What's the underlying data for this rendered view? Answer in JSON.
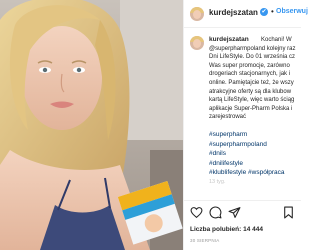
{
  "header": {
    "username": "kurdejszatan",
    "verified_mark": "✔",
    "separator": "•",
    "follow_label": "Obserwuj"
  },
  "caption": {
    "username": "kurdejszatan",
    "text": "Kochani! W\n@superpharmpoland kolejny raz\nDni LifeStyle. Do 01 września cz\nWas super promocje, zarówno\ndrogeriach stacjonarnych, jak i\nonline. Pamiętajcie też, że wszy\natrakcyjne oferty są dla klubow\nkartą LifeStyle, więc warto ściąg\naplikacje Super-Pharm Polska i\nzarejestrować",
    "hashtags": [
      "#superpharm",
      "#superpharmpoland",
      "#dnils",
      "#dnilifestyle",
      "#klublifestyle #współpraca"
    ],
    "time": "13 tyg."
  },
  "actions": {
    "like_icon": "heart-icon",
    "comment_icon": "comment-icon",
    "share_icon": "share-icon",
    "save_icon": "bookmark-icon"
  },
  "stats": {
    "likes_label": "Liczba polubień: 14 444",
    "date": "30 SIERPNIA"
  },
  "colors": {
    "accent": "#3897f0",
    "hashtag": "#003569",
    "text": "#262626"
  }
}
